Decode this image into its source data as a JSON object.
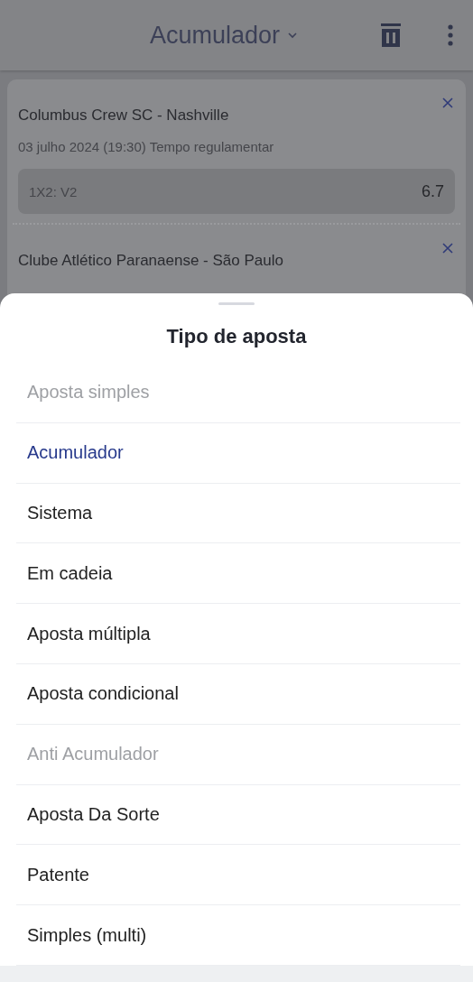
{
  "header": {
    "title": "Acumulador"
  },
  "bets": [
    {
      "match": "Columbus Crew SC - Nashville",
      "details": "03 julho 2024 (19:30) Tempo regulamentar",
      "market": "1X2: V2",
      "odds": "6.7"
    },
    {
      "match": "Clube Atlético Paranaense - São Paulo"
    }
  ],
  "sheet": {
    "title": "Tipo de aposta",
    "options": [
      {
        "label": "Aposta simples",
        "selected": false,
        "disabled": true
      },
      {
        "label": "Acumulador",
        "selected": true,
        "disabled": false
      },
      {
        "label": "Sistema",
        "selected": false,
        "disabled": false
      },
      {
        "label": "Em cadeia",
        "selected": false,
        "disabled": false
      },
      {
        "label": "Aposta múltipla",
        "selected": false,
        "disabled": false
      },
      {
        "label": "Aposta condicional",
        "selected": false,
        "disabled": false
      },
      {
        "label": "Anti Acumulador",
        "selected": false,
        "disabled": true
      },
      {
        "label": "Aposta Da Sorte",
        "selected": false,
        "disabled": false
      },
      {
        "label": "Patente",
        "selected": false,
        "disabled": false
      },
      {
        "label": "Simples (multi)",
        "selected": false,
        "disabled": false
      }
    ]
  }
}
